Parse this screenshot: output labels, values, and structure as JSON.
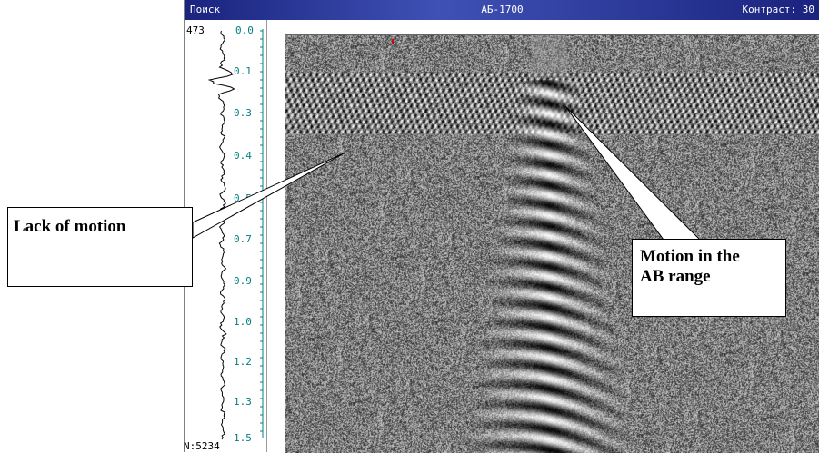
{
  "window": {
    "mode_label": "Поиск",
    "device_label": "АБ-1700",
    "contrast_label": "Контраст: 30"
  },
  "scale": {
    "trace_count": "473",
    "zero_tick": "0.0",
    "ticks": [
      "0.1",
      "0.3",
      "0.4",
      "0.5",
      "0.7",
      "0.9",
      "1.0",
      "1.2",
      "1.3",
      "1.5"
    ],
    "counter": "N:5234"
  },
  "annotations": {
    "lack_of_motion": "Lack of motion",
    "motion_line1": "Motion in the",
    "motion_line2": "AB range"
  },
  "colors": {
    "title_bar_start": "#1a237e",
    "title_bar_end": "#3f51b5",
    "scale_tick": "#008080",
    "trace_line": "#000000"
  }
}
